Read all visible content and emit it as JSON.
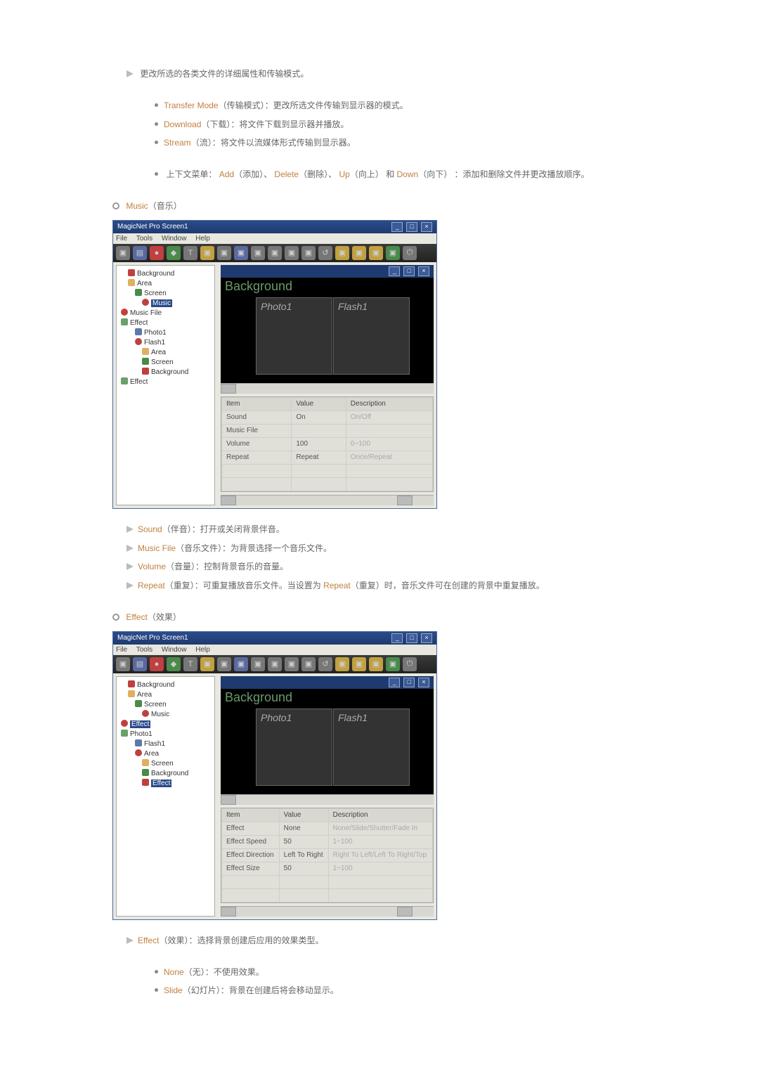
{
  "intro": "更改所选的各类文件的详细属性和传输模式。",
  "transfer_list": [
    {
      "kw": "Transfer Mode",
      "paren": "（传输模式）",
      "desc": "：更改所选文件传输到显示器的模式。"
    },
    {
      "kw": "Download",
      "paren": "（下载）",
      "desc": "：将文件下载到显示器并播放。"
    },
    {
      "kw": "Stream",
      "paren": "（流）",
      "desc": "：将文件以流媒体形式传输到显示器。"
    }
  ],
  "context_menu": {
    "prefix": "上下文菜单：",
    "add": "Add",
    "add_p": "（添加）",
    "delete": "Delete",
    "del_p": "（删除）",
    "up": "Up",
    "up_p": "（向上）",
    "down": "Down",
    "down_p": "（向下）",
    "tail": "：添加和删除文件并更改播放顺序。"
  },
  "music_title": {
    "kw": "Music",
    "paren": "（音乐）"
  },
  "music_notes": [
    {
      "kw": "Sound",
      "paren": "（伴音）",
      "desc": "：打开或关闭背景伴音。"
    },
    {
      "kw": "Music File",
      "paren": "（音乐文件）",
      "desc": "：为背景选择一个音乐文件。"
    },
    {
      "kw": "Volume",
      "paren": "（音量）",
      "desc": "：控制背景音乐的音量。"
    },
    {
      "kw": "Repeat",
      "paren": "（重复）",
      "desc": "：可重复播放音乐文件。当设置为 ",
      "kw2": "Repeat",
      "paren2": "（重复）",
      "desc2": "时，音乐文件可在创建的背景中重复播放。"
    }
  ],
  "effect_title": {
    "kw": "Effect",
    "paren": "（效果）"
  },
  "effect_notes": [
    {
      "kw": "Effect",
      "paren": "（效果）",
      "desc": "：选择背景创建后应用的效果类型。"
    }
  ],
  "effect_sub": [
    {
      "kw": "None",
      "paren": "（无）",
      "desc": "：不使用效果。"
    },
    {
      "kw": "Slide",
      "paren": "（幻灯片）",
      "desc": "：背景在创建后将会移动显示。"
    }
  ],
  "app": {
    "title": "MagicNet Pro Screen1",
    "menus": [
      "File",
      "Tools",
      "Window",
      "Help"
    ],
    "bg_label": "Background",
    "photo": "Photo1",
    "flash": "Flash1",
    "tree_music": [
      "Background",
      "Area",
      "Screen",
      "Music",
      "Music File",
      "Effect",
      "Photo1",
      "Flash1",
      "Area",
      "Screen",
      "Background",
      "Effect"
    ],
    "select_music": "Music",
    "tree_effect": [
      "Background",
      "Area",
      "Screen",
      "Music",
      "Effect",
      "Photo1",
      "Flash1",
      "Area",
      "Screen",
      "Background",
      "Effect"
    ],
    "select_effect": "Effect",
    "grid_headers": [
      "Item",
      "Value",
      "Description"
    ],
    "grid_music": [
      {
        "item": "Sound",
        "value": "On",
        "desc": "On/Off"
      },
      {
        "item": "Music File",
        "value": "",
        "desc": ""
      },
      {
        "item": "Volume",
        "value": "100",
        "desc": "0~100"
      },
      {
        "item": "Repeat",
        "value": "Repeat",
        "desc": "Once/Repeat"
      }
    ],
    "grid_effect": [
      {
        "item": "Effect",
        "value": "None",
        "desc": "None/Slide/Shutter/Fade In"
      },
      {
        "item": "Effect Speed",
        "value": "50",
        "desc": "1~100"
      },
      {
        "item": "Effect Direction",
        "value": "Left To Right",
        "desc": "Right To Left/Left To Right/Top"
      },
      {
        "item": "Effect Size",
        "value": "50",
        "desc": "1~100"
      }
    ]
  }
}
